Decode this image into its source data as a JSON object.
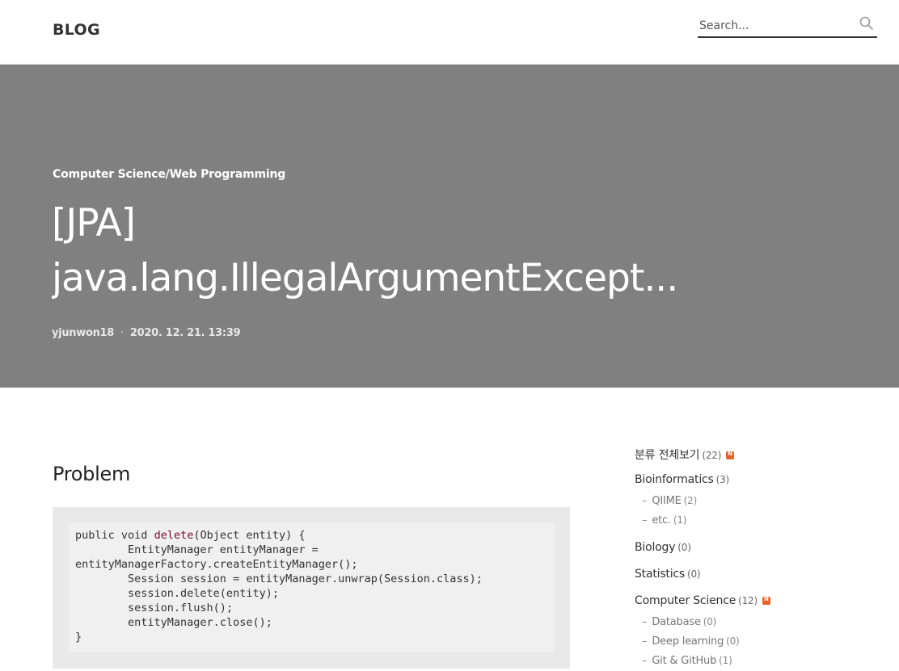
{
  "header": {
    "logo": "BLOG",
    "search_placeholder": "Search..."
  },
  "hero": {
    "category": "Computer Science/Web Programming",
    "title_line1": "[JPA]",
    "title_line2": "java.lang.IllegalArgumentExcept...",
    "author": "yjunwon18",
    "separator": "·",
    "date": "2020. 12. 21. 13:39"
  },
  "content": {
    "section_heading": "Problem",
    "code": {
      "l1_kw1": "public",
      "l1_kw2": "void",
      "l1_fn": "delete",
      "l1_rest": "(Object entity) {",
      "l2": "        EntityManager entityManager =",
      "l3": "entityManagerFactory.createEntityManager();",
      "l4": "        Session session = entityManager.unwrap(Session.class);",
      "l5": "        session.delete(entity);",
      "l6": "        session.flush();",
      "l7": "        entityManager.close();",
      "l8": "}"
    }
  },
  "sidebar": {
    "all": {
      "label": "분류 전체보기",
      "count": "(22)"
    },
    "bioinformatics": {
      "label": "Bioinformatics",
      "count": "(3)"
    },
    "qiime": {
      "label": "QIIME",
      "count": "(2)"
    },
    "etc": {
      "label": "etc.",
      "count": "(1)"
    },
    "biology": {
      "label": "Biology",
      "count": "(0)"
    },
    "statistics": {
      "label": "Statistics",
      "count": "(0)"
    },
    "computer_science": {
      "label": "Computer Science",
      "count": "(12)"
    },
    "database": {
      "label": "Database",
      "count": "(0)"
    },
    "deep_learning": {
      "label": "Deep learning",
      "count": "(0)"
    },
    "git": {
      "label": "Git & GitHub",
      "count": "(1)"
    },
    "dash": "–",
    "new_badge_icon": "new-badge-icon"
  },
  "colors": {
    "hero_bg": "#808080",
    "badge": "#e8622b",
    "code_fn": "#7b0a2e"
  }
}
